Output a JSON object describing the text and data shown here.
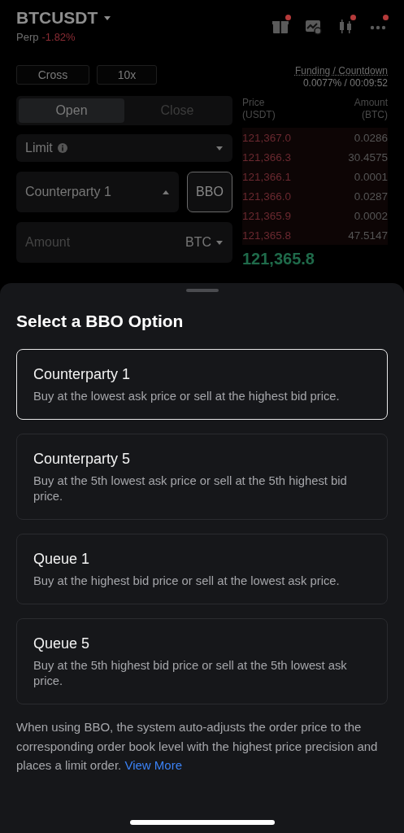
{
  "header": {
    "symbol": "BTCUSDT",
    "market": "Perp",
    "change": "-1.82%",
    "toolbar_icons": [
      {
        "kind": "gift",
        "badge": true
      },
      {
        "kind": "chart",
        "badge": false
      },
      {
        "kind": "candles",
        "badge": true
      },
      {
        "kind": "more",
        "badge": true
      }
    ]
  },
  "margin_mode": "Cross",
  "leverage": "10x",
  "funding": {
    "label": "Funding / Countdown",
    "value": "0.0077% / 00:09:52"
  },
  "tabs": [
    {
      "label": "Open",
      "selected": true
    },
    {
      "label": "Close",
      "selected": false
    }
  ],
  "order_type": "Limit",
  "price_field": {
    "value": "Counterparty 1",
    "expanded": true
  },
  "bbo_button": {
    "label": "BBO",
    "on": true
  },
  "amount_field": {
    "placeholder": "Amount",
    "unit": "BTC"
  },
  "order_book": {
    "columns": [
      {
        "label": "Price",
        "unit": "(USDT)"
      },
      {
        "label": "Amount",
        "unit": "(BTC)"
      }
    ],
    "asks": [
      {
        "price": "121,367.0",
        "amount": "0.0286"
      },
      {
        "price": "121,366.3",
        "amount": "30.4575"
      },
      {
        "price": "121,366.1",
        "amount": "0.0001"
      },
      {
        "price": "121,366.0",
        "amount": "0.0287"
      },
      {
        "price": "121,365.9",
        "amount": "0.0002"
      },
      {
        "price": "121,365.8",
        "amount": "47.5147"
      }
    ],
    "last_price": "121,365.8"
  },
  "sheet": {
    "title": "Select a BBO Option",
    "options": [
      {
        "title": "Counterparty 1",
        "description": "Buy at the lowest ask price or sell at the highest bid price.",
        "selected": true
      },
      {
        "title": "Counterparty 5",
        "description": "Buy at the 5th lowest ask price or sell at the 5th highest bid price.",
        "selected": false
      },
      {
        "title": "Queue 1",
        "description": "Buy at the highest bid price or sell at the lowest ask price.",
        "selected": false
      },
      {
        "title": "Queue 5",
        "description": "Buy at the 5th highest bid price or sell at the 5th lowest ask price.",
        "selected": false
      }
    ],
    "note": "When using BBO, the system auto-adjusts the order price to the corresponding order book level with the highest price precision and places a limit order.",
    "link": "View More"
  }
}
